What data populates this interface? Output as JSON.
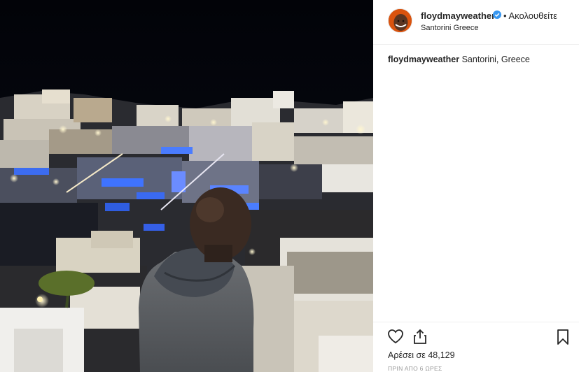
{
  "post": {
    "username": "floydmayweather",
    "follow_label": "• Ακολουθείτε",
    "location": "Santorini Greece",
    "caption_user": "floydmayweather",
    "caption_text": " Santorini, Greece",
    "likes_label": "Αρέσει σε 48,129",
    "time_label": "ΠΡΙΝ ΑΠΟ 6 ΩΡΕΣ"
  },
  "icons": {
    "like": "heart-icon",
    "share": "share-icon",
    "save": "bookmark-icon",
    "verified": "verified-badge-icon"
  },
  "colors": {
    "verified_blue": "#3897f0",
    "avatar_orange": "#d9530e"
  }
}
